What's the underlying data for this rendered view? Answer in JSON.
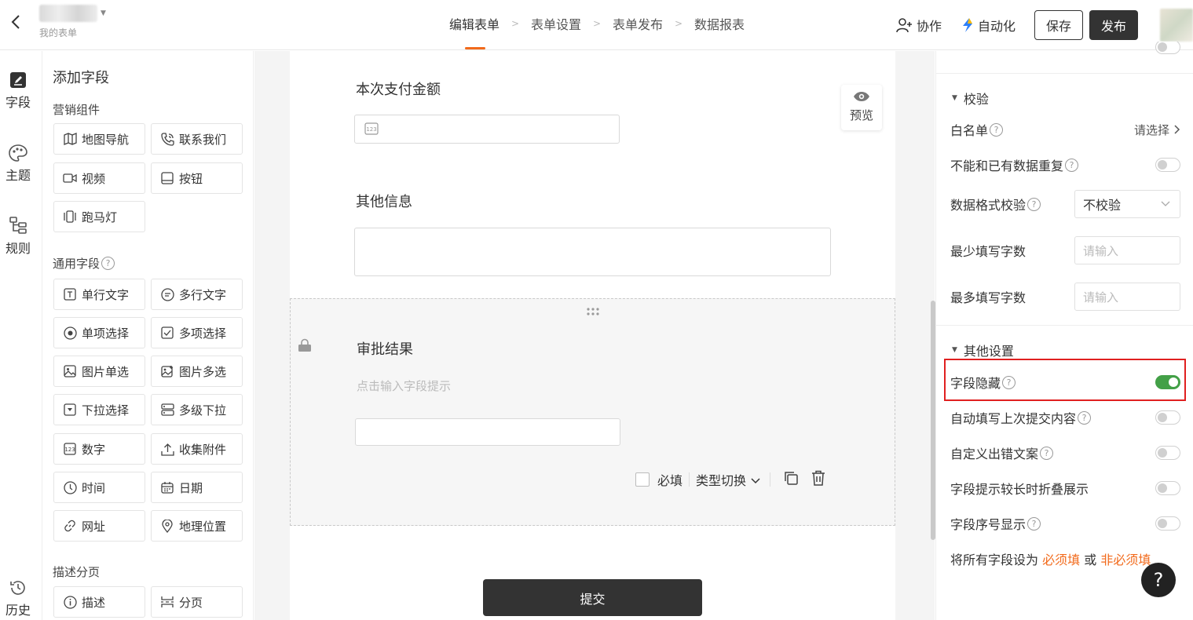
{
  "header": {
    "form_subtitle": "我的表单",
    "steps": [
      "编辑表单",
      "表单设置",
      "表单发布",
      "数据报表"
    ],
    "collab": "协作",
    "automation": "自动化",
    "save": "保存",
    "publish": "发布"
  },
  "rail": {
    "fields": "字段",
    "theme": "主题",
    "rules": "规则",
    "history": "历史"
  },
  "palette": {
    "title": "添加字段",
    "group_marketing": "营销组件",
    "marketing": [
      "地图导航",
      "联系我们",
      "视频",
      "按钮",
      "跑马灯"
    ],
    "group_common": "通用字段",
    "common": [
      "单行文字",
      "多行文字",
      "单项选择",
      "多项选择",
      "图片单选",
      "图片多选",
      "下拉选择",
      "多级下拉",
      "数字",
      "收集附件",
      "时间",
      "日期",
      "网址",
      "地理位置"
    ],
    "group_desc": "描述分页",
    "desc": [
      "描述",
      "分页"
    ]
  },
  "canvas": {
    "field1_label": "本次支付金额",
    "field2_label": "其他信息",
    "field3_label": "审批结果",
    "field3_hint": "点击输入字段提示",
    "required": "必填",
    "type_switch": "类型切换",
    "preview": "预览",
    "submit": "提交"
  },
  "right": {
    "sec_validate": "校验",
    "whitelist": "白名单",
    "whitelist_value": "请选择",
    "no_dup": "不能和已有数据重复",
    "format_check": "数据格式校验",
    "format_value": "不校验",
    "min_chars": "最少填写字数",
    "max_chars": "最多填写字数",
    "input_placeholder": "请输入",
    "sec_other": "其他设置",
    "hide_field": "字段隐藏",
    "autofill": "自动填写上次提交内容",
    "custom_err": "自定义出错文案",
    "collapse_hint": "字段提示较长时折叠展示",
    "show_index": "字段序号显示",
    "bulk_prefix": "将所有字段设为",
    "bulk_required": "必须填",
    "bulk_or": "或",
    "bulk_optional": "非必须填",
    "toggles": {
      "hide_field": true,
      "no_dup": false,
      "autofill": false,
      "custom_err": false,
      "collapse_hint": false,
      "show_index": false
    }
  },
  "help": "?",
  "colors": {
    "accent": "#f26a1b",
    "toggle_on": "#43a047",
    "dark": "#333333",
    "highlight": "#e02020"
  }
}
